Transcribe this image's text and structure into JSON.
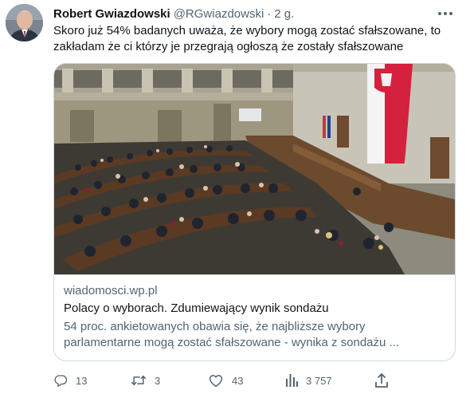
{
  "author": {
    "name": "Robert Gwiazdowski",
    "handle": "@RGwiazdowski",
    "separator": "·",
    "time": "2 g."
  },
  "tweet": {
    "text_line1": "Skoro już 54% badanych uważa, że wybory mogą zostać sfałszowane, to",
    "text_line2": "zakładam że ci którzy je przegrają ogłoszą że zostały sfałszowane"
  },
  "card": {
    "domain": "wiadomosci.wp.pl",
    "title": "Polacy o wyborach. Zdumiewający wynik sondażu",
    "desc_line1": "54 proc. ankietowanych obawia się, że najbliższe wybory",
    "desc_line2": "parlamentarne mogą zostać sfałszowane - wynika z sondażu ..."
  },
  "actions": {
    "replies": "13",
    "retweets": "3",
    "likes": "43",
    "views": "3 757"
  },
  "icons": {
    "more": "more-horizontal-icon",
    "reply": "reply-icon",
    "retweet": "retweet-icon",
    "like": "heart-icon",
    "views": "analytics-icon",
    "share": "share-icon"
  },
  "colors": {
    "text": "#0f1419",
    "secondary": "#536471",
    "border": "#cfd9de",
    "flag_red": "#d4213d"
  }
}
